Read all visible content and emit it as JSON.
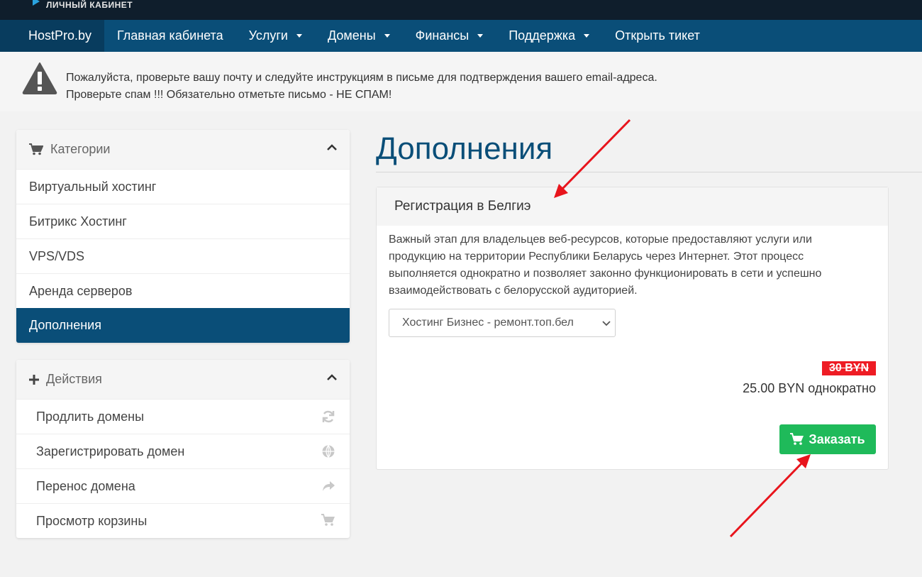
{
  "brand": {
    "subtitle": "ЛИЧНЫЙ КАБИНЕТ"
  },
  "nav": {
    "brand": "HostPro.by",
    "items": [
      {
        "label": "Главная кабинета",
        "dropdown": false
      },
      {
        "label": "Услуги",
        "dropdown": true
      },
      {
        "label": "Домены",
        "dropdown": true
      },
      {
        "label": "Финансы",
        "dropdown": true
      },
      {
        "label": "Поддержка",
        "dropdown": true
      },
      {
        "label": "Открыть тикет",
        "dropdown": false
      }
    ]
  },
  "alert": {
    "line1": "Пожалуйста, проверьте вашу почту и следуйте инструкциям в письме для подтверждения вашего email-адреса.",
    "line2": "Проверьте спам !!! Обязательно отметьте письмо - НЕ СПАМ!"
  },
  "categories": {
    "title": "Категории",
    "items": [
      "Виртуальный хостинг",
      "Битрикс Хостинг",
      "VPS/VDS",
      "Аренда серверов",
      "Дополнения"
    ],
    "active": "Дополнения"
  },
  "actions": {
    "title": "Действия",
    "items": [
      {
        "label": "Продлить домены",
        "icon": "refresh-icon"
      },
      {
        "label": "Зарегистрировать домен",
        "icon": "globe-icon"
      },
      {
        "label": "Перенос домена",
        "icon": "share-arrow-icon"
      },
      {
        "label": "Просмотр корзины",
        "icon": "cart-icon"
      }
    ]
  },
  "main": {
    "title": "Дополнения",
    "product": {
      "name": "Регистрация в Белгиэ",
      "description": "Важный этап для владельцев веб-ресурсов, которые предоставляют услуги или продукцию на территории Республики Беларусь через Интернет. Этот процесс выполняется однократно и позволяет законно функционировать в сети и успешно взаимодействовать с белорусской аудиторией.",
      "select_value": "Хостинг Бизнес - ремонт.топ.бел",
      "old_price": "30 BYN",
      "price": "25.00 BYN однократно",
      "order_label": "Заказать"
    }
  },
  "colors": {
    "navbar": "#0a4e78",
    "brandbar": "#0f1e2c",
    "active_item": "#0a4e78",
    "order_button": "#1fba5a",
    "old_price_badge": "#ee1c24",
    "annotation_arrow": "#e8141c"
  }
}
